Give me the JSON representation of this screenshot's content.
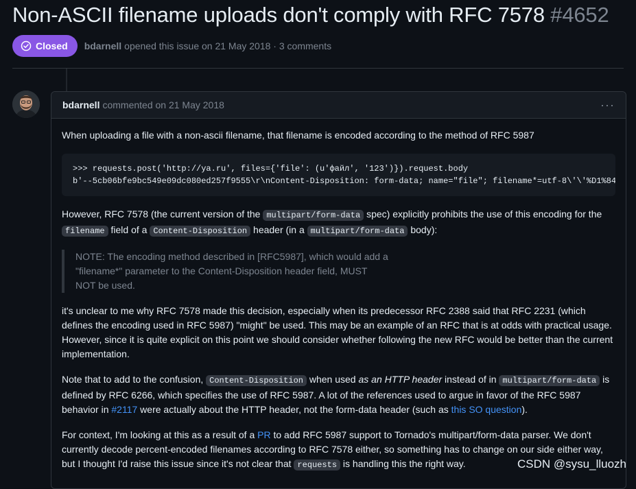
{
  "issue": {
    "title": "Non-ASCII filename uploads don't comply with RFC 7578",
    "number": "#4652",
    "state": "Closed",
    "author": "bdarnell",
    "opened_text": "opened this issue on 21 May 2018 · 3 comments",
    "state_color": "#8957e5"
  },
  "comment": {
    "author": "bdarnell",
    "date_text": "commented on 21 May 2018",
    "menu_label": "···",
    "p1": "When uploading a file with a non-ascii filename, that filename is encoded according to the method of RFC 5987",
    "code_lines": [
      ">>> requests.post('http://ya.ru', files={'file': (u'файл', '123')}).request.body",
      "b'--5cb06bfe9bc549e09dc080ed257f9555\\r\\nContent-Disposition: form-data; name=\"file\"; filename*=utf-8\\'\\'%D1%84"
    ],
    "p2": {
      "t1": "However, RFC 7578 (the current version of the ",
      "c1": "multipart/form-data",
      "t2": " spec) explicitly prohibits the use of this encoding for the ",
      "c2": "filename",
      "t3": " field of a ",
      "c3": "Content-Disposition",
      "t4": " header (in a ",
      "c4": "multipart/form-data",
      "t5": " body):"
    },
    "quote_lines": [
      "NOTE: The encoding method described in [RFC5987], which would add a",
      "\"filename*\" parameter to the Content-Disposition header field, MUST",
      "NOT be used."
    ],
    "p3": "it's unclear to me why RFC 7578 made this decision, especially when its predecessor RFC 2388 said that RFC 2231 (which defines the encoding used in RFC 5987) \"might\" be used. This may be an example of an RFC that is at odds with practical usage. However, since it is quite explicit on this point we should consider whether following the new RFC would be better than the current implementation.",
    "p4": {
      "t1": "Note that to add to the confusion, ",
      "c1": "Content-Disposition",
      "t2": " when used ",
      "em1": "as an HTTP header",
      "t3": " instead of in ",
      "c2": "multipart/form-data",
      "t4": " is defined by RFC 6266, which specifies the use of RFC 5987. A lot of the references used to argue in favor of the RFC 5987 behavior in ",
      "link1": "#2117",
      "t5": " were actually about the HTTP header, not the form-data header (such as ",
      "link2": "this SO question",
      "t6": ")."
    },
    "p5": {
      "t1": "For context, I'm looking at this as a result of a ",
      "link1": "PR",
      "t2": " to add RFC 5987 support to Tornado's multipart/form-data parser. We don't currently decode percent-encoded filenames according to RFC 7578 either, so something has to change on our side either way, but I thought I'd raise this issue since it's not clear that ",
      "c1": "requests",
      "t3": " is handling this the right way."
    }
  },
  "watermark": "CSDN @sysu_lluozh"
}
